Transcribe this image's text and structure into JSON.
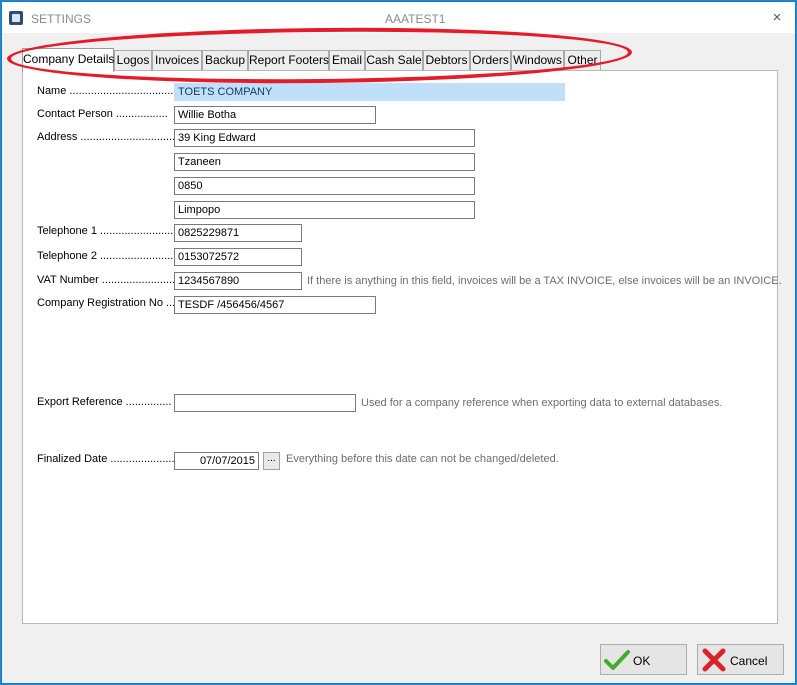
{
  "window": {
    "title": "SETTINGS",
    "subtitle": "AAATEST1",
    "close_glyph": "×"
  },
  "tabs": [
    {
      "label": "Company Details",
      "active": true
    },
    {
      "label": "Logos"
    },
    {
      "label": "Invoices"
    },
    {
      "label": "Backup"
    },
    {
      "label": "Report Footers"
    },
    {
      "label": "Email"
    },
    {
      "label": "Cash Sale"
    },
    {
      "label": "Debtors"
    },
    {
      "label": "Orders"
    },
    {
      "label": "Windows"
    },
    {
      "label": "Other"
    }
  ],
  "form": {
    "name_label": "Name ..................................",
    "name_value": "TOETS COMPANY",
    "contact_label": "Contact Person .................",
    "contact_value": "Willie Botha",
    "address_label": "Address ................................",
    "address_lines": [
      "39 King Edward",
      "Tzaneen",
      "0850",
      "Limpopo"
    ],
    "tel1_label": "Telephone 1 ........................",
    "tel1_value": "0825229871",
    "tel2_label": "Telephone 2 ........................",
    "tel2_value": "0153072572",
    "vat_label": "VAT Number ........................",
    "vat_value": "1234567890",
    "vat_hint": "If there is anything in this field, invoices will be a TAX INVOICE, else invoices will be an INVOICE.",
    "reg_label": "Company Registration No ....",
    "reg_value": "TESDF /456456/4567",
    "export_label": "Export Reference ...............",
    "export_value": "",
    "export_hint": "Used for a company reference when exporting data to external databases.",
    "finalized_label": "Finalized Date ......................",
    "finalized_value": "07/07/2015",
    "finalized_button": "...",
    "finalized_hint": "Everything before this date can not be changed/deleted."
  },
  "footer": {
    "ok_label": "OK",
    "cancel_label": "Cancel"
  },
  "colors": {
    "annotation": "#e41b2a",
    "highlight": "#bfe0f8",
    "ok_icon": "#3fae2a",
    "cancel_icon": "#d9232d"
  }
}
